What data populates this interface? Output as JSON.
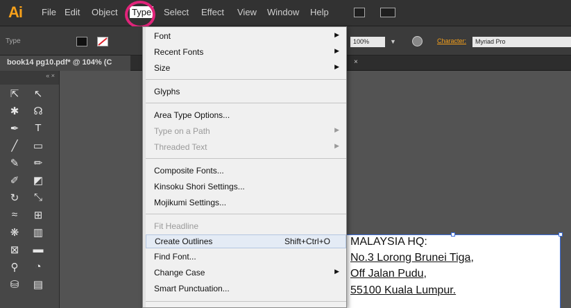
{
  "menubar": {
    "logo": "Ai",
    "items": [
      "File",
      "Edit",
      "Object",
      "Type",
      "Select",
      "Effect",
      "View",
      "Window",
      "Help"
    ]
  },
  "control_bar": {
    "label": "Type",
    "zoom": "100%",
    "character_link": "Character:",
    "font_name": "Myriad Pro"
  },
  "document_tab": {
    "title": "book14 pg10.pdf* @ 104% (C",
    "close": "×"
  },
  "tools_panel": {
    "header": "«  ×",
    "tools": [
      [
        "selection-tool-icon",
        "direct-selection-tool-icon"
      ],
      [
        "magic-wand-tool-icon",
        "lasso-tool-icon"
      ],
      [
        "pen-tool-icon",
        "type-tool-icon"
      ],
      [
        "line-segment-tool-icon",
        "rectangle-tool-icon"
      ],
      [
        "paintbrush-tool-icon",
        "pencil-tool-icon"
      ],
      [
        "blob-brush-tool-icon",
        "eraser-tool-icon"
      ],
      [
        "rotate-tool-icon",
        "scale-tool-icon"
      ],
      [
        "width-tool-icon",
        "free-transform-tool-icon"
      ],
      [
        "symbol-sprayer-tool-icon",
        "column-graph-tool-icon"
      ],
      [
        "mesh-tool-icon",
        "gradient-tool-icon"
      ],
      [
        "eyedropper-tool-icon",
        "blend-tool-icon"
      ],
      [
        "live-paint-tool-icon",
        "slice-tool-icon"
      ]
    ]
  },
  "type_menu": {
    "groups": [
      [
        {
          "label": "Font",
          "submenu": true,
          "disabled": false
        },
        {
          "label": "Recent Fonts",
          "submenu": true,
          "disabled": false
        },
        {
          "label": "Size",
          "submenu": true,
          "disabled": false
        }
      ],
      [
        {
          "label": "Glyphs",
          "submenu": false,
          "disabled": false
        }
      ],
      [
        {
          "label": "Area Type Options...",
          "submenu": false,
          "disabled": false
        },
        {
          "label": "Type on a Path",
          "submenu": true,
          "disabled": true
        },
        {
          "label": "Threaded Text",
          "submenu": true,
          "disabled": true
        }
      ],
      [
        {
          "label": "Composite Fonts...",
          "submenu": false,
          "disabled": false
        },
        {
          "label": "Kinsoku Shori Settings...",
          "submenu": false,
          "disabled": false
        },
        {
          "label": "Mojikumi Settings...",
          "submenu": false,
          "disabled": false
        }
      ],
      [
        {
          "label": "Fit Headline",
          "submenu": false,
          "disabled": true
        },
        {
          "label": "Create Outlines",
          "shortcut": "Shift+Ctrl+O",
          "submenu": false,
          "disabled": false,
          "highlighted": true
        },
        {
          "label": "Find Font...",
          "submenu": false,
          "disabled": false
        },
        {
          "label": "Change Case",
          "submenu": true,
          "disabled": false
        },
        {
          "label": "Smart Punctuation...",
          "submenu": false,
          "disabled": false
        }
      ]
    ]
  },
  "artboard_text": {
    "lines": [
      "MALAYSIA HQ:",
      "No.3 Lorong Brunei Tiga,",
      "Off Jalan Pudu,",
      "55100 Kuala Lumpur."
    ]
  }
}
